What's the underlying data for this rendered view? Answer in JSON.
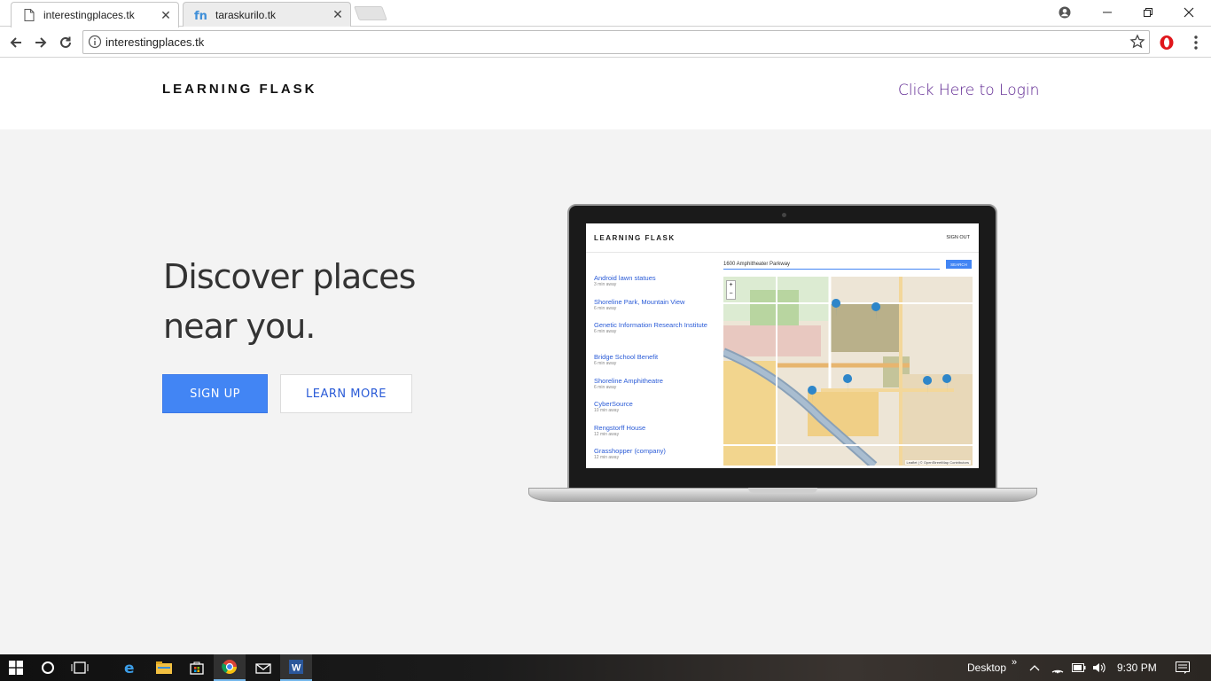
{
  "browser": {
    "tabs": [
      {
        "title": "interestingplaces.tk",
        "active": true
      },
      {
        "title": "taraskurilo.tk",
        "active": false
      }
    ],
    "tab_close_glyph": "✕",
    "url": "interestingplaces.tk"
  },
  "site": {
    "brand": "LEARNING FLASK",
    "login_link": "Click Here to Login",
    "hero": {
      "headline_line1": "Discover places",
      "headline_line2": "near you.",
      "signup_label": "SIGN UP",
      "learn_more_label": "LEARN MORE"
    },
    "colors": {
      "primary": "#4285f4",
      "link_visited": "#551a8b",
      "hero_bg": "#f3f3f3"
    }
  },
  "mini_app": {
    "brand": "LEARNING FLASK",
    "signout": "SIGN OUT",
    "search_value": "1600 Amphitheater Parkway",
    "search_button": "SEARCH",
    "places": [
      {
        "name": "Android lawn statues",
        "distance": "3 min away"
      },
      {
        "name": "Shoreline Park, Mountain View",
        "distance": "6 min away"
      },
      {
        "name": "Genetic Information Research Institute",
        "distance": "6 min away"
      },
      {
        "name": "Bridge School Benefit",
        "distance": "6 min away"
      },
      {
        "name": "Shoreline Amphitheatre",
        "distance": "6 min away"
      },
      {
        "name": "CyberSource",
        "distance": "10 min away"
      },
      {
        "name": "Rengstorff House",
        "distance": "12 min away"
      },
      {
        "name": "Grasshopper (company)",
        "distance": "12 min away"
      }
    ],
    "map_attribution": "Leaflet | © OpenStreetMap Contributors"
  },
  "taskbar": {
    "desktop_label": "Desktop",
    "time": "9:30 PM"
  }
}
